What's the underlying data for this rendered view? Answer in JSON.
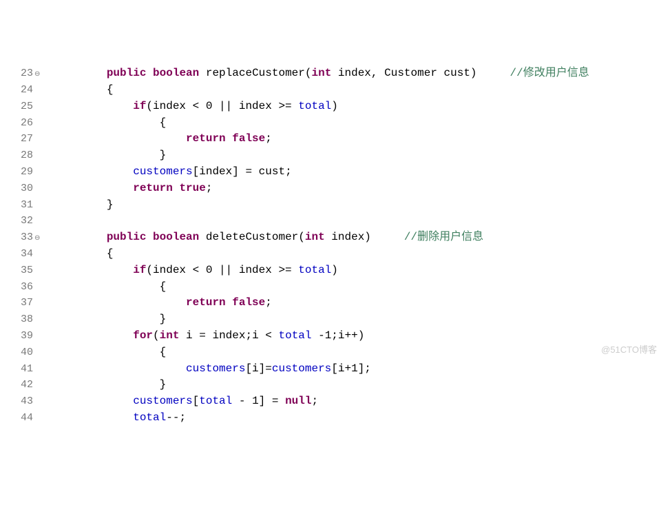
{
  "watermark": "@51CTO博客",
  "lines": [
    {
      "num": "23",
      "marker": "⊖",
      "indent": 2,
      "tokens": [
        {
          "t": "kw",
          "v": "public"
        },
        {
          "t": "plain",
          "v": " "
        },
        {
          "t": "kw",
          "v": "boolean"
        },
        {
          "t": "plain",
          "v": " replaceCustomer("
        },
        {
          "t": "kw",
          "v": "int"
        },
        {
          "t": "plain",
          "v": " index, Customer cust)     "
        },
        {
          "t": "cmt",
          "v": "//修改用户信息"
        }
      ]
    },
    {
      "num": "24",
      "marker": "",
      "indent": 2,
      "tokens": [
        {
          "t": "plain",
          "v": "{"
        }
      ]
    },
    {
      "num": "25",
      "marker": "",
      "indent": 3,
      "tokens": [
        {
          "t": "kw",
          "v": "if"
        },
        {
          "t": "plain",
          "v": "(index < 0 || index >= "
        },
        {
          "t": "field",
          "v": "total"
        },
        {
          "t": "plain",
          "v": ")"
        }
      ]
    },
    {
      "num": "26",
      "marker": "",
      "indent": 4,
      "tokens": [
        {
          "t": "plain",
          "v": "{"
        }
      ]
    },
    {
      "num": "27",
      "marker": "",
      "indent": 5,
      "tokens": [
        {
          "t": "kw",
          "v": "return"
        },
        {
          "t": "plain",
          "v": " "
        },
        {
          "t": "lit",
          "v": "false"
        },
        {
          "t": "plain",
          "v": ";"
        }
      ]
    },
    {
      "num": "28",
      "marker": "",
      "indent": 4,
      "tokens": [
        {
          "t": "plain",
          "v": "}"
        }
      ]
    },
    {
      "num": "29",
      "marker": "",
      "indent": 3,
      "tokens": [
        {
          "t": "field",
          "v": "customers"
        },
        {
          "t": "plain",
          "v": "[index] = cust;"
        }
      ]
    },
    {
      "num": "30",
      "marker": "",
      "indent": 3,
      "tokens": [
        {
          "t": "kw",
          "v": "return"
        },
        {
          "t": "plain",
          "v": " "
        },
        {
          "t": "lit",
          "v": "true"
        },
        {
          "t": "plain",
          "v": ";"
        }
      ]
    },
    {
      "num": "31",
      "marker": "",
      "indent": 2,
      "tokens": [
        {
          "t": "plain",
          "v": "}"
        }
      ]
    },
    {
      "num": "32",
      "marker": "",
      "indent": 2,
      "tokens": []
    },
    {
      "num": "33",
      "marker": "⊖",
      "indent": 2,
      "tokens": [
        {
          "t": "kw",
          "v": "public"
        },
        {
          "t": "plain",
          "v": " "
        },
        {
          "t": "kw",
          "v": "boolean"
        },
        {
          "t": "plain",
          "v": " deleteCustomer("
        },
        {
          "t": "kw",
          "v": "int"
        },
        {
          "t": "plain",
          "v": " index)     "
        },
        {
          "t": "cmt",
          "v": "//删除用户信息"
        }
      ]
    },
    {
      "num": "34",
      "marker": "",
      "indent": 2,
      "tokens": [
        {
          "t": "plain",
          "v": "{"
        }
      ]
    },
    {
      "num": "35",
      "marker": "",
      "indent": 3,
      "tokens": [
        {
          "t": "kw",
          "v": "if"
        },
        {
          "t": "plain",
          "v": "(index < 0 || index >= "
        },
        {
          "t": "field",
          "v": "total"
        },
        {
          "t": "plain",
          "v": ")"
        }
      ]
    },
    {
      "num": "36",
      "marker": "",
      "indent": 4,
      "tokens": [
        {
          "t": "plain",
          "v": "{"
        }
      ]
    },
    {
      "num": "37",
      "marker": "",
      "indent": 5,
      "tokens": [
        {
          "t": "kw",
          "v": "return"
        },
        {
          "t": "plain",
          "v": " "
        },
        {
          "t": "lit",
          "v": "false"
        },
        {
          "t": "plain",
          "v": ";"
        }
      ]
    },
    {
      "num": "38",
      "marker": "",
      "indent": 4,
      "tokens": [
        {
          "t": "plain",
          "v": "}"
        }
      ]
    },
    {
      "num": "39",
      "marker": "",
      "indent": 3,
      "tokens": [
        {
          "t": "kw",
          "v": "for"
        },
        {
          "t": "plain",
          "v": "("
        },
        {
          "t": "kw",
          "v": "int"
        },
        {
          "t": "plain",
          "v": " i = index;i < "
        },
        {
          "t": "field",
          "v": "total"
        },
        {
          "t": "plain",
          "v": " -1;i++)"
        }
      ]
    },
    {
      "num": "40",
      "marker": "",
      "indent": 4,
      "tokens": [
        {
          "t": "plain",
          "v": "{"
        }
      ]
    },
    {
      "num": "41",
      "marker": "",
      "indent": 5,
      "tokens": [
        {
          "t": "field",
          "v": "customers"
        },
        {
          "t": "plain",
          "v": "[i]="
        },
        {
          "t": "field",
          "v": "customers"
        },
        {
          "t": "plain",
          "v": "[i+1];"
        }
      ]
    },
    {
      "num": "42",
      "marker": "",
      "indent": 4,
      "tokens": [
        {
          "t": "plain",
          "v": "}"
        }
      ]
    },
    {
      "num": "43",
      "marker": "",
      "indent": 3,
      "tokens": [
        {
          "t": "field",
          "v": "customers"
        },
        {
          "t": "plain",
          "v": "["
        },
        {
          "t": "field",
          "v": "total"
        },
        {
          "t": "plain",
          "v": " - 1] = "
        },
        {
          "t": "lit",
          "v": "null"
        },
        {
          "t": "plain",
          "v": ";"
        }
      ]
    },
    {
      "num": "44",
      "marker": "",
      "indent": 3,
      "tokens": [
        {
          "t": "field",
          "v": "total"
        },
        {
          "t": "plain",
          "v": "--;"
        }
      ]
    }
  ]
}
